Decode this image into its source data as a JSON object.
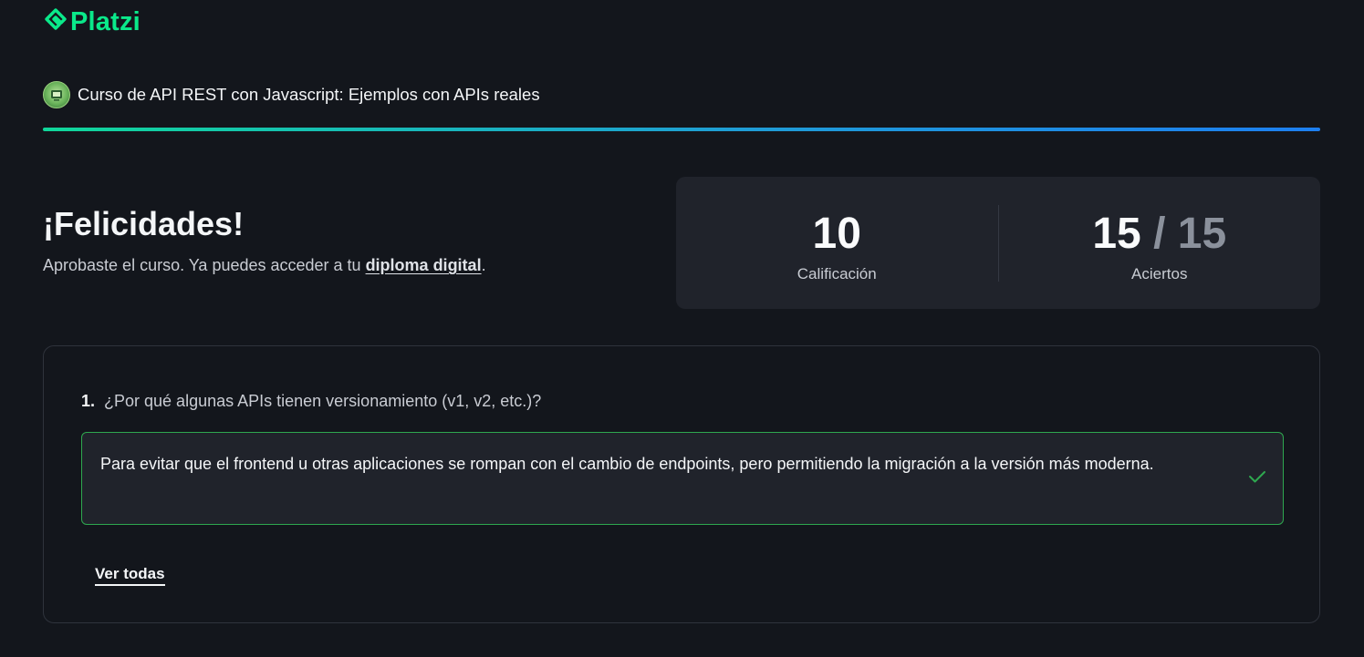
{
  "brand": {
    "name": "Platzi",
    "logo_icon": "platzi-logo-icon",
    "color": "#0ae98a"
  },
  "course": {
    "badge_icon": "course-badge-icon",
    "title": "Curso de API REST con Javascript: Ejemplos con APIs reales"
  },
  "progress": {
    "percent": 100,
    "gradient": [
      "#10d79a",
      "#1d7ff0"
    ]
  },
  "result": {
    "heading": "¡Felicidades!",
    "message_prefix": "Aprobaste el curso. Ya puedes acceder a tu ",
    "diploma_link": "diploma digital",
    "message_suffix": "."
  },
  "stats": {
    "score_value": "10",
    "score_label": "Calificación",
    "correct_value": "15",
    "correct_separator": " / ",
    "total_value": "15",
    "correct_label": "Aciertos"
  },
  "quiz": {
    "question_number": "1.",
    "question_text": "¿Por qué algunas APIs tienen versionamiento (v1, v2, etc.)?",
    "answer_text": "Para evitar que el frontend u otras aplicaciones se rompan con el cambio de endpoints, pero permitiendo la migración a la versión más moderna.",
    "answer_status_icon": "check-icon",
    "correct_color": "#2ea84f",
    "see_all_label": "Ver todas"
  }
}
